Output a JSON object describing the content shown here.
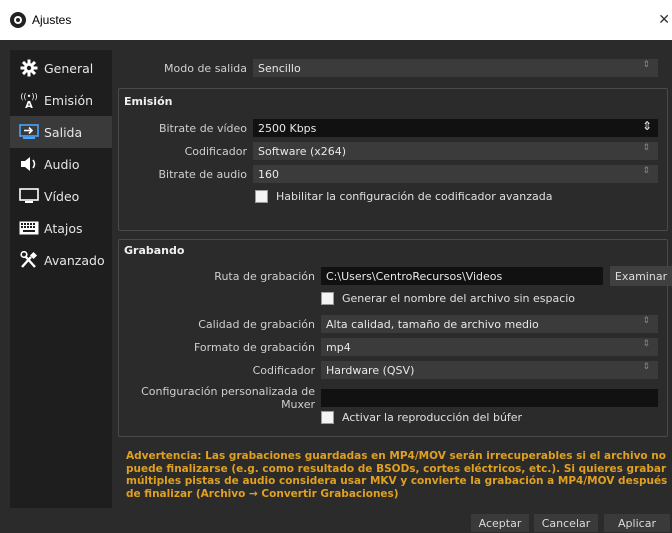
{
  "window": {
    "title": "Ajustes",
    "close": "✕"
  },
  "sidebar": {
    "items": [
      {
        "label": "General",
        "icon": "gear-icon"
      },
      {
        "label": "Emisión",
        "icon": "broadcast-icon"
      },
      {
        "label": "Salida",
        "icon": "output-icon"
      },
      {
        "label": "Audio",
        "icon": "speaker-icon"
      },
      {
        "label": "Vídeo",
        "icon": "monitor-icon"
      },
      {
        "label": "Atajos",
        "icon": "keyboard-icon"
      },
      {
        "label": "Avanzado",
        "icon": "tools-icon"
      }
    ],
    "active": "Salida"
  },
  "output": {
    "mode_label": "Modo de salida",
    "mode_value": "Sencillo"
  },
  "streaming": {
    "title": "Emisión",
    "video_bitrate_label": "Bitrate de vídeo",
    "video_bitrate_value": "2500 Kbps",
    "encoder_label": "Codificador",
    "encoder_value": "Software (x264)",
    "audio_bitrate_label": "Bitrate de audio",
    "audio_bitrate_value": "160",
    "advanced_label": "Habilitar la configuración de codificador avanzada"
  },
  "recording": {
    "title": "Grabando",
    "path_label": "Ruta de grabación",
    "path_value": "C:\\Users\\CentroRecursos\\Videos",
    "browse_label": "Examinar",
    "nospace_label": "Generar el nombre del archivo sin espacio",
    "quality_label": "Calidad de grabación",
    "quality_value": "Alta calidad, tamaño de archivo medio",
    "format_label": "Formato de grabación",
    "format_value": "mp4",
    "encoder_label": "Codificador",
    "encoder_value": "Hardware (QSV)",
    "muxer_label": "Configuración personalizada de Muxer",
    "muxer_value": "",
    "replay_label": "Activar la reproducción del búfer"
  },
  "warning": "Advertencia: Las grabaciones guardadas en MP4/MOV serán irrecuperables si el archivo no puede finalizarse (e.g. como resultado de BSODs, cortes eléctricos, etc.). Si quieres grabar múltiples pistas de audio considera usar MKV y convierte la grabación a MP4/MOV después de finalizar (Archivo → Convertir Grabaciones)",
  "footer": {
    "accept": "Aceptar",
    "cancel": "Cancelar",
    "apply": "Aplicar"
  },
  "colors": {
    "background": "#2b2b2b",
    "sidebar": "#1e1e1e",
    "warning": "#e0a020"
  }
}
